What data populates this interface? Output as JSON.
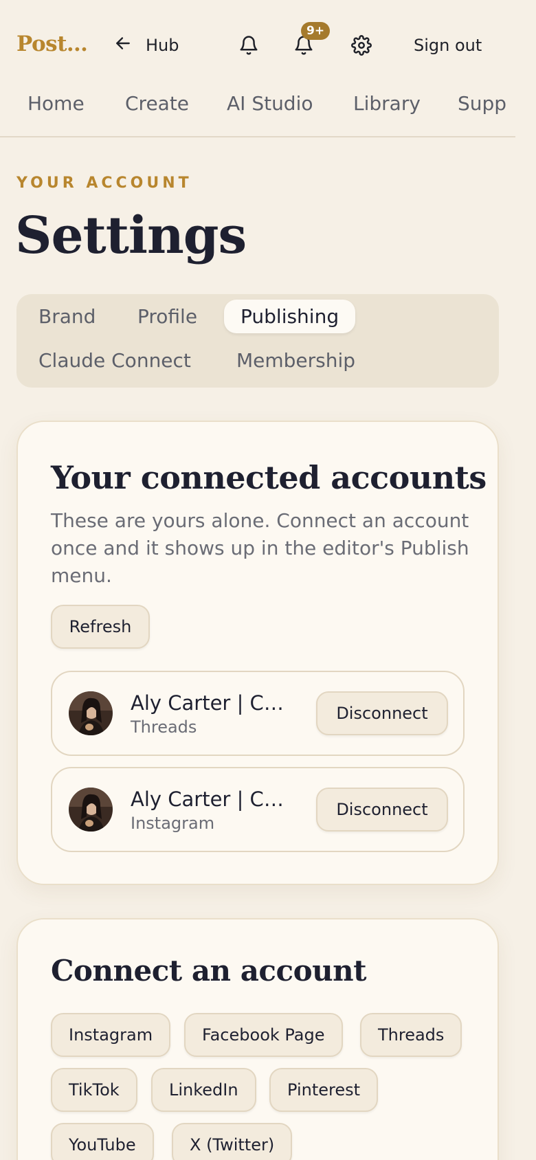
{
  "header": {
    "brand": "Post…",
    "back_label": "Hub",
    "notification_badge": "9+",
    "signout_label": "Sign out"
  },
  "nav": {
    "items": [
      "Home",
      "Create",
      "AI Studio",
      "Library",
      "Supp"
    ]
  },
  "page": {
    "eyebrow": "YOUR ACCOUNT",
    "title": "Settings"
  },
  "tabs": {
    "items": [
      "Brand",
      "Profile",
      "Publishing",
      "Claude Connect",
      "Membership"
    ],
    "active": "Publishing"
  },
  "connected": {
    "title": "Your connected accounts",
    "description": "These are yours alone. Connect an account once and it shows up in the editor's Publish menu.",
    "refresh_label": "Refresh",
    "accounts": [
      {
        "name": "Aly Carter | Cus...",
        "platform": "Threads",
        "action": "Disconnect"
      },
      {
        "name": "Aly Carter | Cus...",
        "platform": "Instagram",
        "action": "Disconnect"
      }
    ]
  },
  "connect": {
    "title": "Connect an account",
    "platforms": [
      "Instagram",
      "Facebook Page",
      "Threads",
      "TikTok",
      "LinkedIn",
      "Pinterest",
      "YouTube",
      "X (Twitter)"
    ]
  },
  "colors": {
    "background": "#f6f0e6",
    "accent": "#b8862e",
    "badge": "#a57a2c",
    "card": "#fdf9f2"
  }
}
